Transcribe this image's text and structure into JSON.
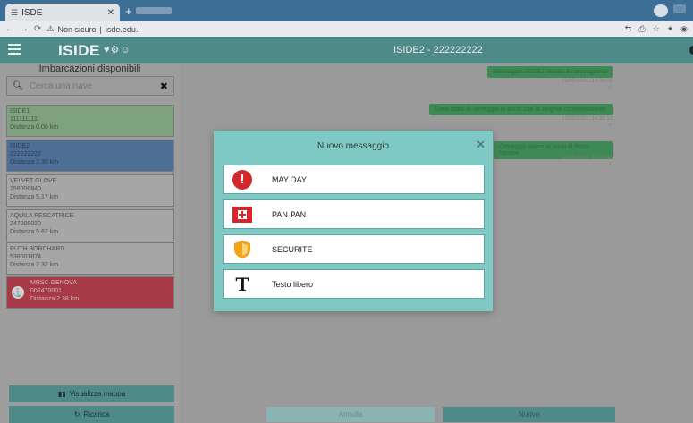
{
  "browser": {
    "tab_title": "ISDE",
    "url_label": "Non sicuro",
    "url_host": "isde.edu.i"
  },
  "app": {
    "brand": "ISIDE",
    "brand_glyphs": "♥⚙☺",
    "vessel_title": "ISIDE2 - 222222222"
  },
  "sidebar": {
    "title": "Imbarcazioni disponibili",
    "search": {
      "placeholder": "Cerca una nave",
      "value": ""
    },
    "vessels": [
      {
        "name": "ISIDE1",
        "id": "111111111",
        "distance": "Distanza 0.00 km",
        "status": "green"
      },
      {
        "name": "ISIDE2",
        "id": "222222222",
        "distance": "Distanza 2.30 km",
        "status": "blue"
      },
      {
        "name": "VELVET GLOVE",
        "id": "256000840",
        "distance": "Distanza 5.17 km",
        "status": "grey"
      },
      {
        "name": "AQUILA PESCATRICE",
        "id": "247009030",
        "distance": "Distanza 5.62 km",
        "status": "grey"
      },
      {
        "name": "RUTH BORCHARD",
        "id": "538001874",
        "distance": "Distanza 2.32 km",
        "status": "grey"
      },
      {
        "name": "MRSC GENOVA",
        "id": "002470001",
        "distance": "Distanza 2.38 km",
        "status": "red"
      }
    ],
    "map_button": "Visualizza mappa",
    "back_button": "Ricarica"
  },
  "chat": {
    "messages": [
      {
        "text": "Messaggio ISIDE2 inviato a mezzogiorno",
        "time": "12/05/2021, 14:38:05",
        "mark": "✓"
      },
      {
        "text": "Sono stato di ormeggio in porto con la cinghia completamente",
        "time": "12/05/2021, 14:38:12",
        "mark": "✓"
      },
      {
        "text": "Ormeggio vicino al molo di Porto Venere",
        "time": "12/05/2021, 14:38:40",
        "mark": "✓"
      }
    ],
    "footer_left": "Annulla",
    "footer_right": "Nuovo"
  },
  "modal": {
    "title": "Nuovo messaggio",
    "options": [
      {
        "label": "MAY DAY",
        "icon": "mayday-alert-icon"
      },
      {
        "label": "PAN PAN",
        "icon": "panpan-medical-icon"
      },
      {
        "label": "SECURITE",
        "icon": "securite-shield-icon"
      },
      {
        "label": "Testo libero",
        "icon": "free-text-icon"
      }
    ]
  },
  "colors": {
    "accent": "#4e8a87",
    "modal_bg": "#7fc9c4",
    "danger": "#d2282c",
    "warning": "#f2a21b"
  }
}
